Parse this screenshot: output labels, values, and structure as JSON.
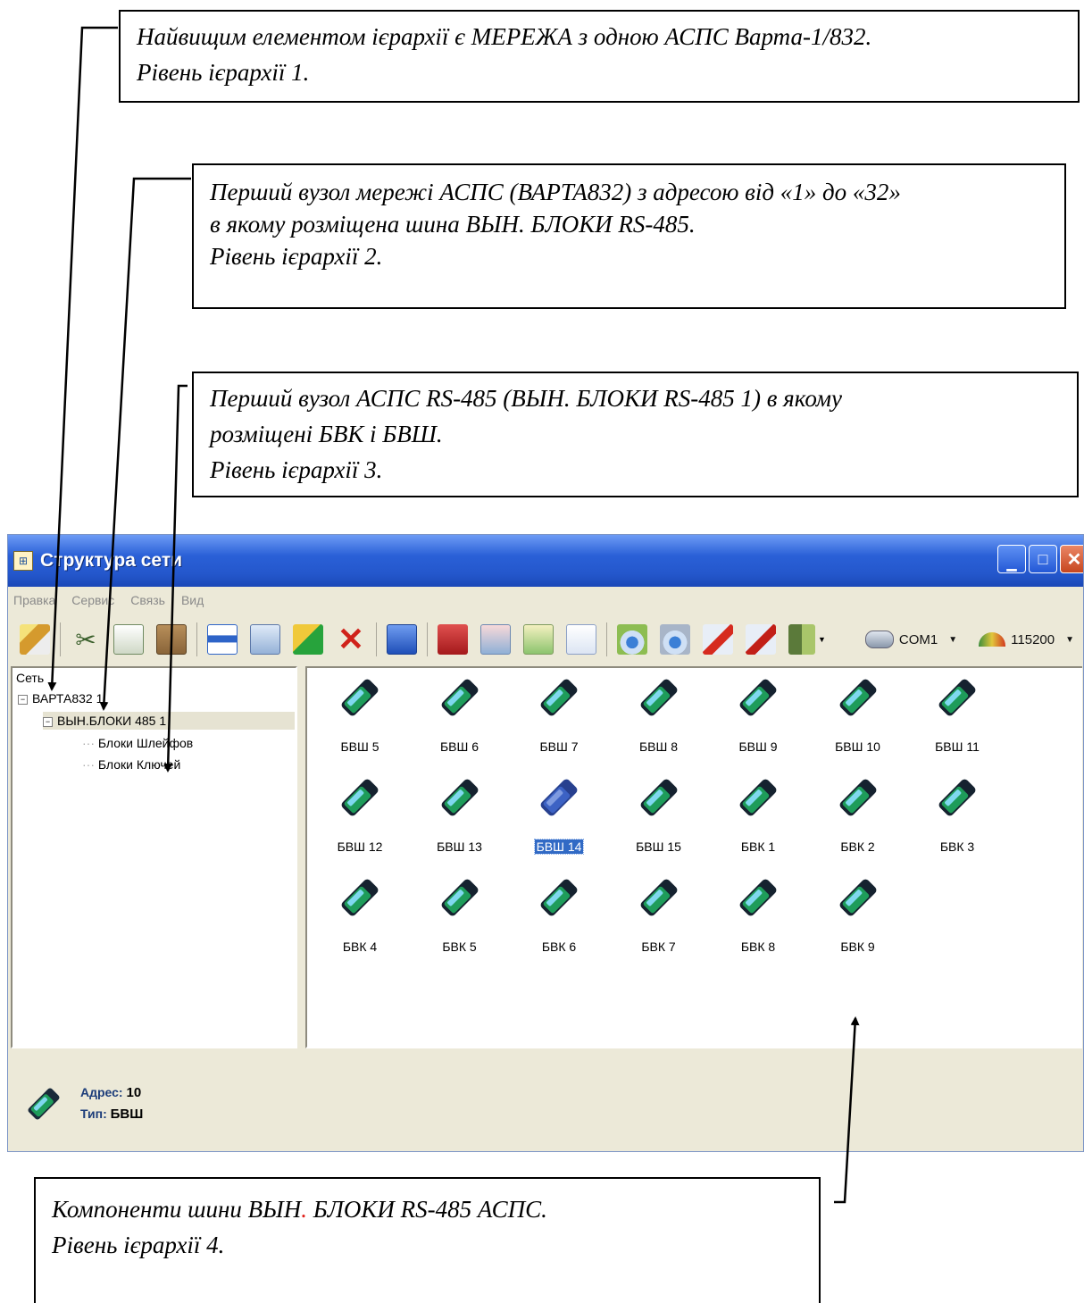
{
  "callouts": {
    "level1": {
      "line1": "Найвищим елементом ієрархії є МЕРЕЖА з одною АСПС Варта-1/832.",
      "line2": "Рівень ієрархії 1."
    },
    "level2": {
      "line1": "Перший вузол мережі АСПС (ВАРТА832) з адресою від «1» до «32»",
      "line2": "в якому розміщена шина ВЫН. БЛОКИ RS-485.",
      "line3": "Рівень ієрархії 2."
    },
    "level3": {
      "line1": "Перший вузол АСПС RS-485 (ВЫН. БЛОКИ RS-485 1) в якому",
      "line2": "розміщені БВК і БВШ.",
      "line3": "Рівень ієрархії 3."
    },
    "level4": {
      "line1_a": "Компоненти шини ВЫН",
      "line1_dot": ".",
      "line1_b": " БЛОКИ RS-485 АСПС.",
      "line2": "Рівень ієрархії 4."
    }
  },
  "window": {
    "title": "Структура сети",
    "menu": [
      "Правка",
      "Сервис",
      "Связь",
      "Вид"
    ],
    "port": "COM1",
    "baud": "115200",
    "tree": {
      "root": "Сеть",
      "node1": "ВАРТА832 1",
      "node2": "ВЫН.БЛОКИ 485 1",
      "leaf1": "Блоки Шлейфов",
      "leaf2": "Блоки Ключей"
    },
    "devices": [
      "БВШ 5",
      "БВШ 6",
      "БВШ 7",
      "БВШ 8",
      "БВШ 9",
      "БВШ 10",
      "БВШ 11",
      "БВШ 12",
      "БВШ 13",
      "БВШ 14",
      "БВШ 15",
      "БВК 1",
      "БВК 2",
      "БВК 3",
      "БВК 4",
      "БВК 5",
      "БВК 6",
      "БВК 7",
      "БВК 8",
      "БВК 9"
    ],
    "selected_device": "БВШ 14",
    "status": {
      "addr_label": "Адрес:",
      "addr_value": "10",
      "type_label": "Тип:",
      "type_value": "БВШ"
    }
  },
  "colors": {
    "titlebar": "#2457cc",
    "window_bg": "#ece9d8",
    "selection": "#316ac5",
    "device_green": "#1e9c5a",
    "accent_red": "#e0201a"
  }
}
